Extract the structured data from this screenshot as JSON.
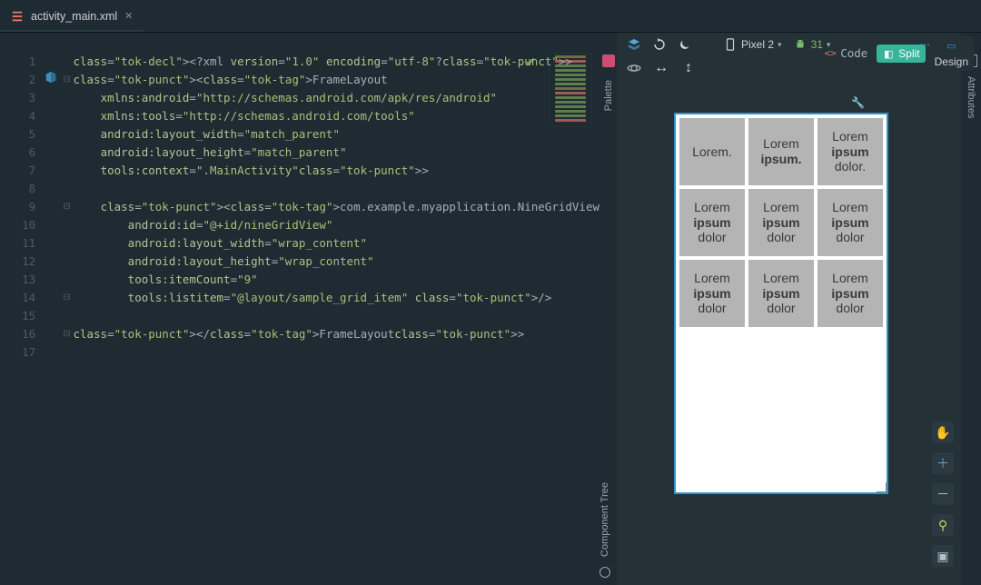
{
  "tab": {
    "filename": "activity_main.xml"
  },
  "viewmodes": {
    "code": "Code",
    "split": "Split",
    "design": "Design"
  },
  "code_lines": [
    "<?xml version=\"1.0\" encoding=\"utf-8\"?>",
    "<FrameLayout",
    "    xmlns:android=\"http://schemas.android.com/apk/res/android\"",
    "    xmlns:tools=\"http://schemas.android.com/tools\"",
    "    android:layout_width=\"match_parent\"",
    "    android:layout_height=\"match_parent\"",
    "    tools:context=\".MainActivity\">",
    "",
    "    <com.example.myapplication.NineGridView",
    "        android:id=\"@+id/nineGridView\"",
    "        android:layout_width=\"wrap_content\"",
    "        android:layout_height=\"wrap_content\"",
    "        tools:itemCount=\"9\"",
    "        tools:listitem=\"@layout/sample_grid_item\" />",
    "",
    "</FrameLayout>",
    ""
  ],
  "line_count": 17,
  "design_toolbar": {
    "device": "Pixel 2",
    "api": "31"
  },
  "side_tabs": {
    "palette": "Palette",
    "component_tree": "Component Tree",
    "attributes": "Attributes"
  },
  "preview": {
    "cells": [
      "Lorem.",
      "Lorem ipsum.",
      "Lorem ipsum dolor.",
      "Lorem ipsum dolor",
      "Lorem ipsum dolor",
      "Lorem ipsum dolor",
      "Lorem ipsum dolor",
      "Lorem ipsum dolor",
      "Lorem ipsum dolor"
    ]
  }
}
